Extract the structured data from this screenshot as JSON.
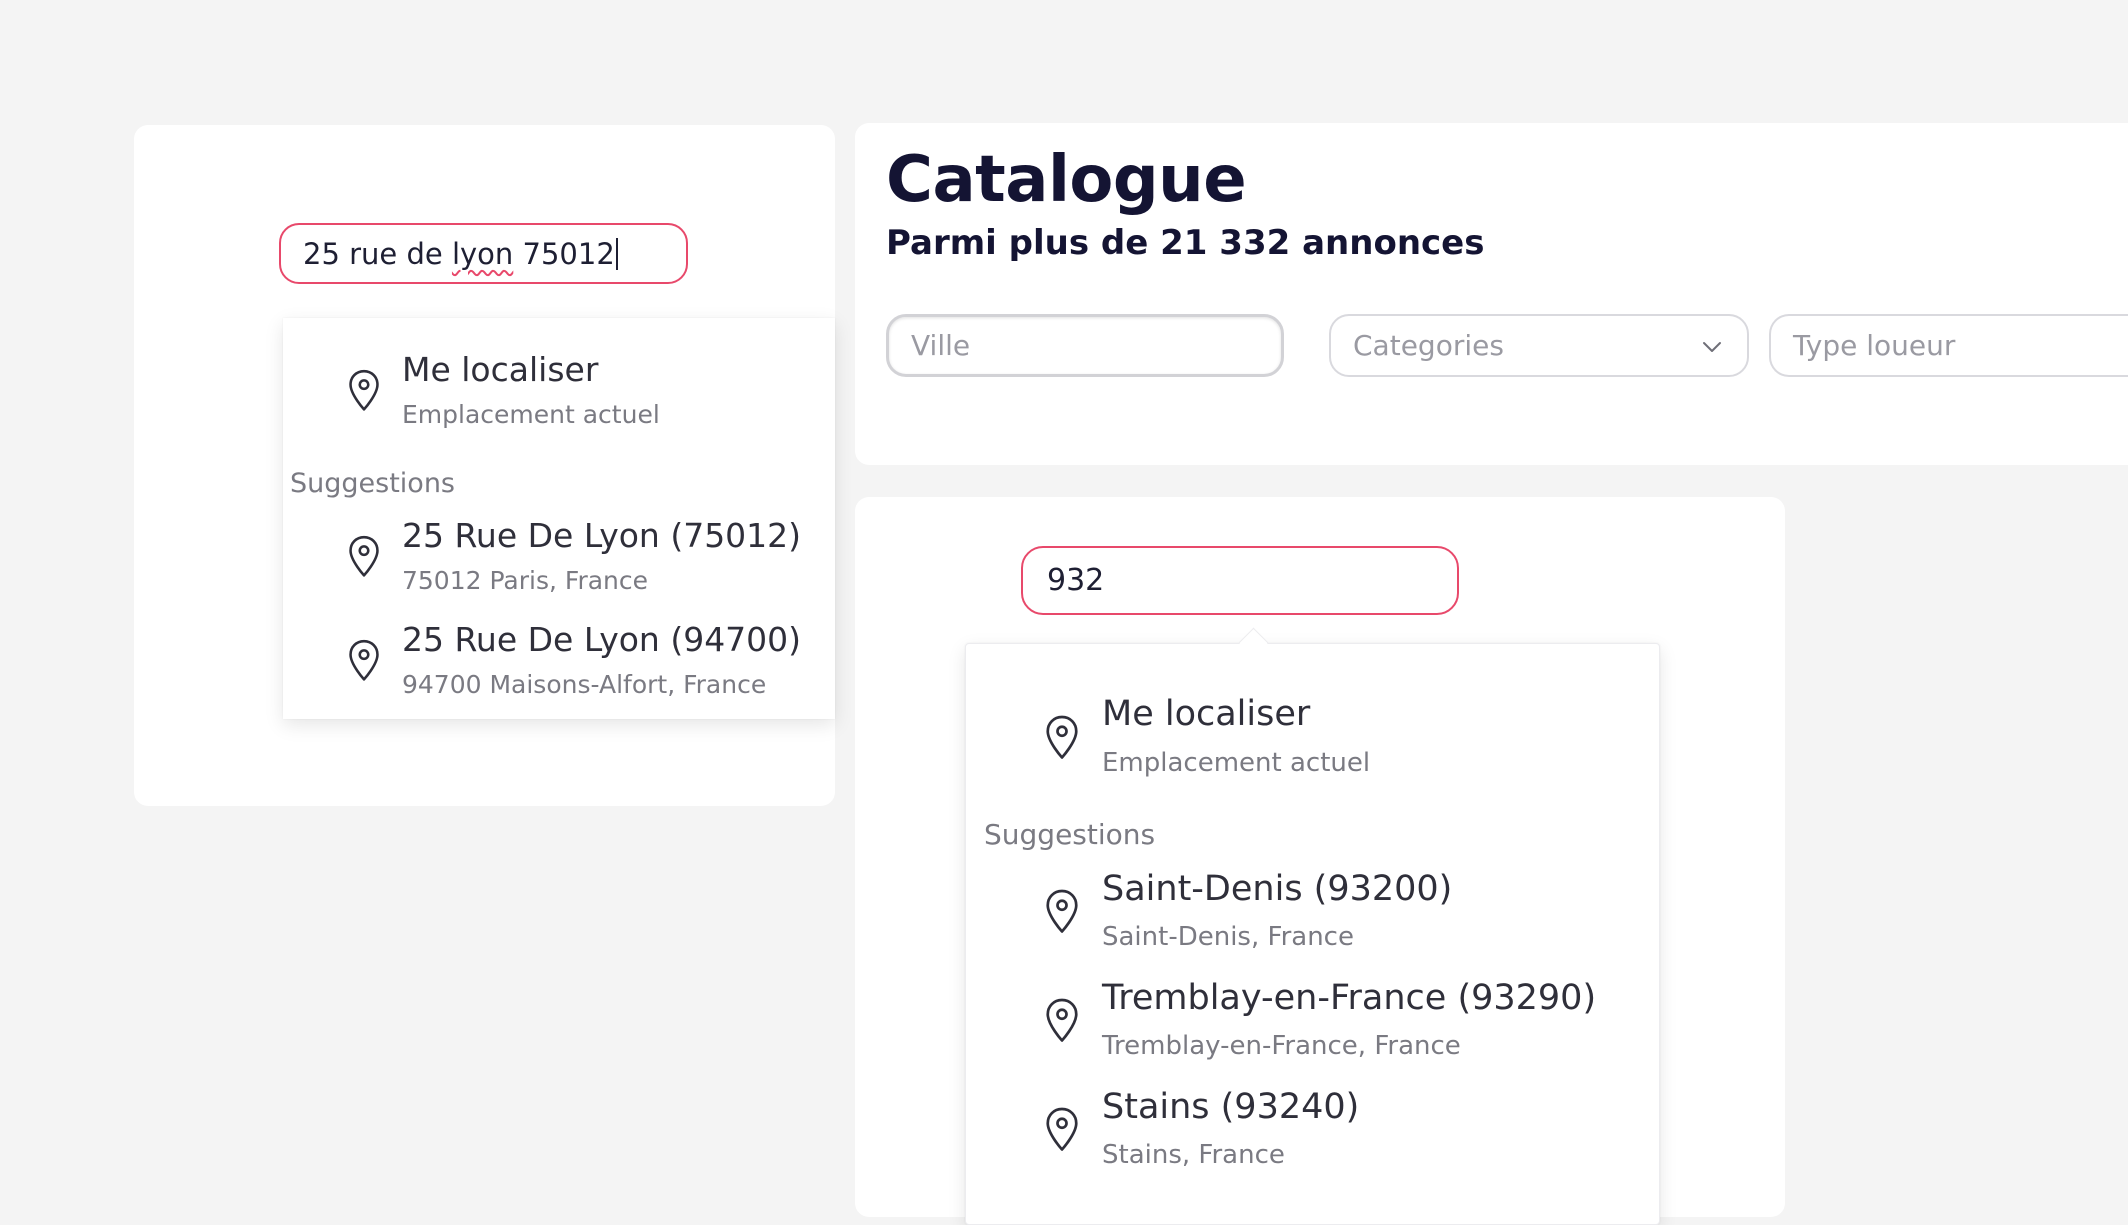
{
  "left_panel": {
    "input_value": "25 rue de ",
    "input_misspelled": "lyon",
    "input_rest": " 75012",
    "locate": {
      "title": "Me localiser",
      "subtitle": "Emplacement actuel"
    },
    "suggestions_label": "Suggestions",
    "suggestions": [
      {
        "title": "25 Rue De Lyon (75012)",
        "subtitle": "75012 Paris, France"
      },
      {
        "title": "25 Rue De Lyon (94700)",
        "subtitle": "94700 Maisons-Alfort, France"
      }
    ]
  },
  "catalogue": {
    "title": "Catalogue",
    "subtitle": "Parmi plus de 21 332 annonces",
    "filters": {
      "ville_placeholder": "Ville",
      "categories_placeholder": "Categories",
      "type_placeholder": "Type loueur"
    }
  },
  "right_panel": {
    "input_value": "932",
    "locate": {
      "title": "Me localiser",
      "subtitle": "Emplacement actuel"
    },
    "suggestions_label": "Suggestions",
    "suggestions": [
      {
        "title": "Saint-Denis (93200)",
        "subtitle": "Saint-Denis, France"
      },
      {
        "title": "Tremblay-en-France (93290)",
        "subtitle": "Tremblay-en-France, France"
      },
      {
        "title": "Stains (93240)",
        "subtitle": "Stains, France"
      }
    ]
  },
  "colors": {
    "background": "#f4f4f4",
    "accent": "#e8496b",
    "title": "#141433",
    "muted": "#7a7a82"
  },
  "icons": {
    "pin": "map-pin-icon",
    "chevron": "chevron-down-icon"
  }
}
